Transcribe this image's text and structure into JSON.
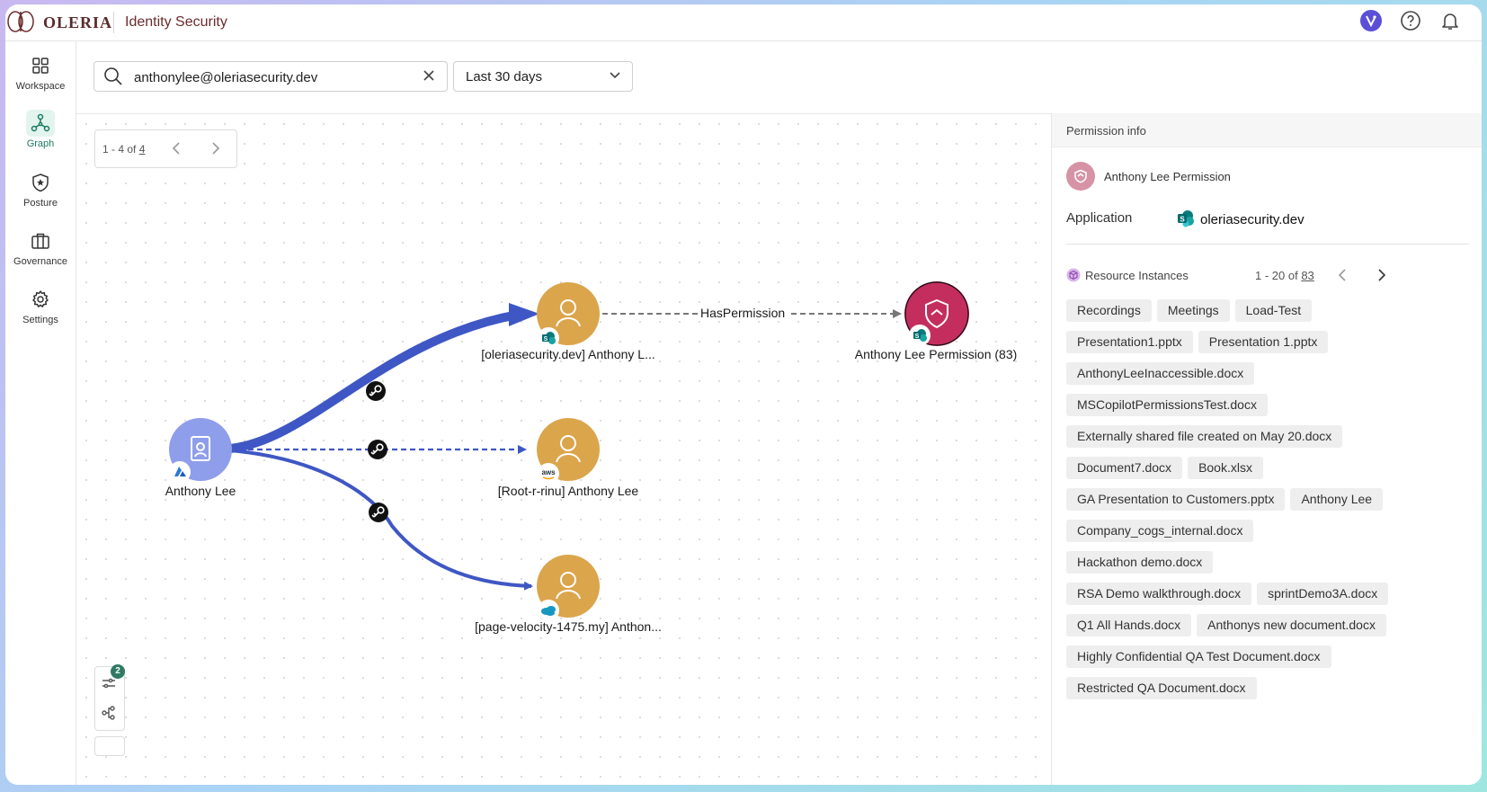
{
  "brand": {
    "name": "OLERIA",
    "product": "Identity Security"
  },
  "topbar": {
    "icons": [
      "copilot-icon",
      "help-icon",
      "bell-icon"
    ]
  },
  "nav": {
    "items": [
      {
        "label": "Workspace",
        "icon": "grid-icon",
        "active": false
      },
      {
        "label": "Graph",
        "icon": "graph-icon",
        "active": true
      },
      {
        "label": "Posture",
        "icon": "shield-star-icon",
        "active": false
      },
      {
        "label": "Governance",
        "icon": "briefcase-icon",
        "active": false
      },
      {
        "label": "Settings",
        "icon": "gear-icon",
        "active": false
      }
    ]
  },
  "filters": {
    "search_value": "anthonylee@oleriasecurity.dev",
    "date_range": "Last 30 days"
  },
  "graph": {
    "pager": {
      "range": "1 - 4 of",
      "total": "4"
    },
    "nodes": {
      "source": "Anthony Lee",
      "sharepoint_user": "[oleriasecurity.dev] Anthony L...",
      "aws_user": "[Root-r-rinu] Anthony Lee",
      "salesforce_user": "[page-velocity-1475.my] Anthon...",
      "permission": "Anthony Lee Permission (83)"
    },
    "edge_label": "HasPermission",
    "filter_badge": "2",
    "colors": {
      "edge": "#3f57c4",
      "user_node": "#dba54c",
      "source_node": "#8f9eea",
      "permission_node": "#c42e5e"
    }
  },
  "panel": {
    "title": "Permission info",
    "permission_name": "Anthony Lee Permission",
    "application_label": "Application",
    "application_value": "oleriasecurity.dev",
    "resources_title": "Resource Instances",
    "resources_pager": {
      "range": "1 - 20 of",
      "total": "83"
    },
    "resources": [
      "Recordings",
      "Meetings",
      "Load-Test",
      "Presentation1.pptx",
      "Presentation 1.pptx",
      "AnthonyLeeInaccessible.docx",
      "MSCopilotPermissionsTest.docx",
      "Externally shared file created on May 20.docx",
      "Document7.docx",
      "Book.xlsx",
      "GA Presentation to Customers.pptx",
      "Anthony Lee",
      "Company_cogs_internal.docx",
      "Hackathon demo.docx",
      "RSA Demo walkthrough.docx",
      "sprintDemo3A.docx",
      "Q1 All Hands.docx",
      "Anthonys new document.docx",
      "Highly Confidential QA Test Document.docx",
      "Restricted QA Document.docx"
    ]
  }
}
